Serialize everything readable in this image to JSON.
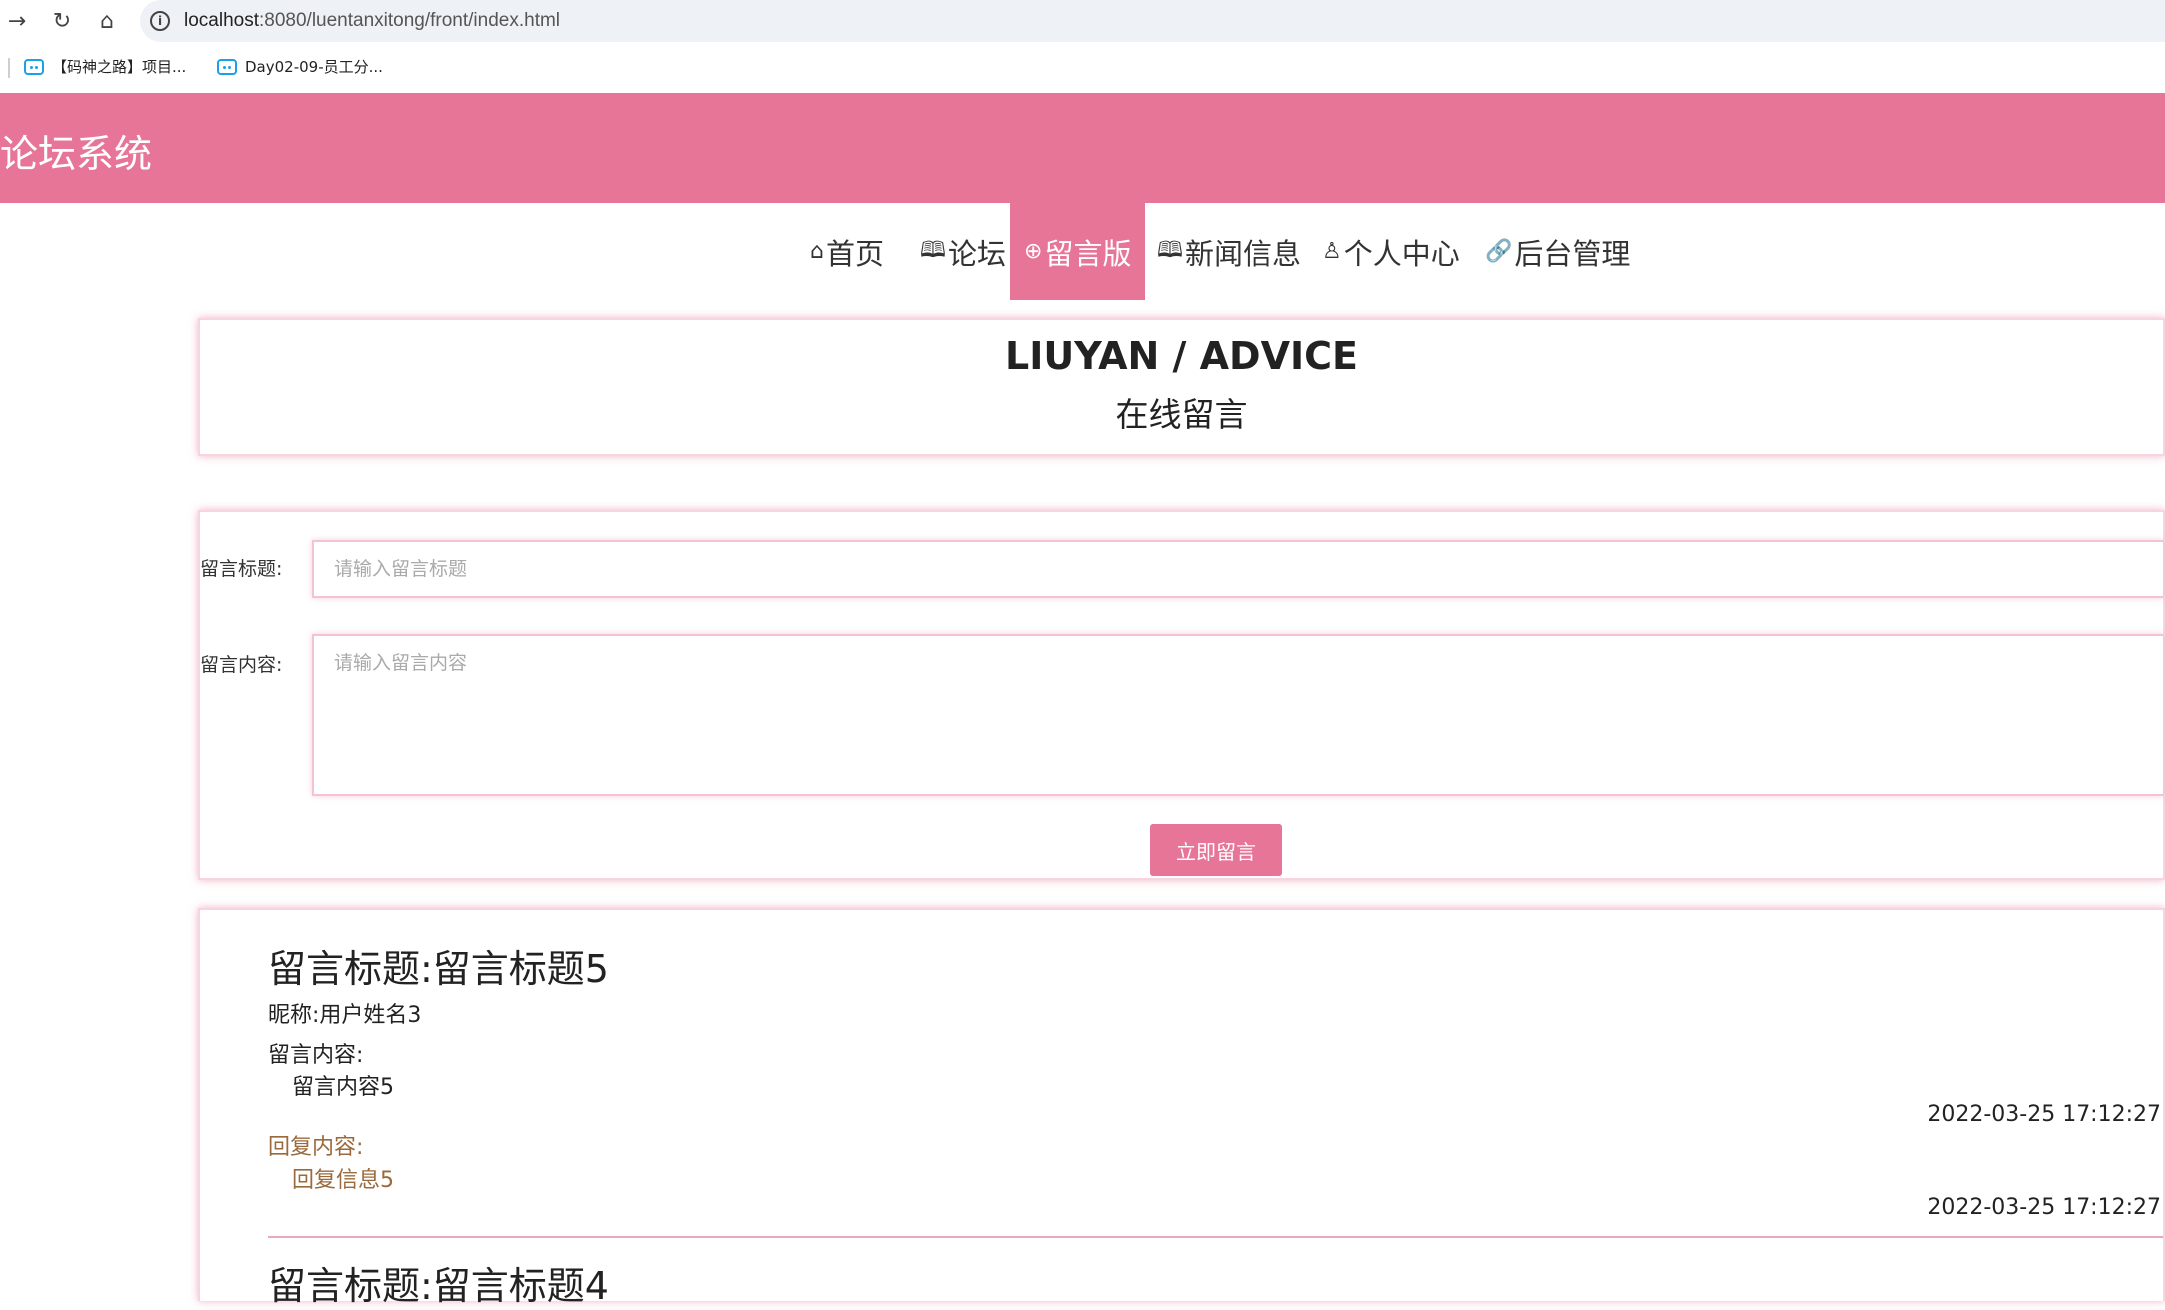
{
  "browser": {
    "url_host": "localhost",
    "url_rest": ":8080/luentanxitong/front/index.html",
    "bookmarks": [
      {
        "label": "【码神之路】项目..."
      },
      {
        "label": "Day02-09-员工分..."
      }
    ]
  },
  "site": {
    "title": "论坛系统",
    "accent_color": "#e67597"
  },
  "nav": {
    "items": [
      {
        "icon": "home-icon",
        "label": "首页"
      },
      {
        "icon": "book-open-icon",
        "label": "论坛"
      },
      {
        "icon": "globe-icon",
        "label": "留言版"
      },
      {
        "icon": "newspaper-icon",
        "label": "新闻信息"
      },
      {
        "icon": "user-icon",
        "label": "个人中心"
      },
      {
        "icon": "link-icon",
        "label": "后台管理"
      }
    ],
    "active_index": 2
  },
  "page_heading": {
    "en": "LIUYAN / ADVICE",
    "zh": "在线留言"
  },
  "form": {
    "title_label": "留言标题:",
    "title_placeholder": "请输入留言标题",
    "content_label": "留言内容:",
    "content_placeholder": "请输入留言内容",
    "submit_label": "立即留言"
  },
  "messages": [
    {
      "title": "留言标题:留言标题5",
      "nickname_line": "昵称:用户姓名3",
      "content_label": "留言内容:",
      "content": "留言内容5",
      "time": "2022-03-25 17:12:27",
      "reply_label": "回复内容:",
      "reply": "回复信息5",
      "reply_time": "2022-03-25 17:12:27"
    },
    {
      "title": "留言标题:留言标题4"
    }
  ]
}
